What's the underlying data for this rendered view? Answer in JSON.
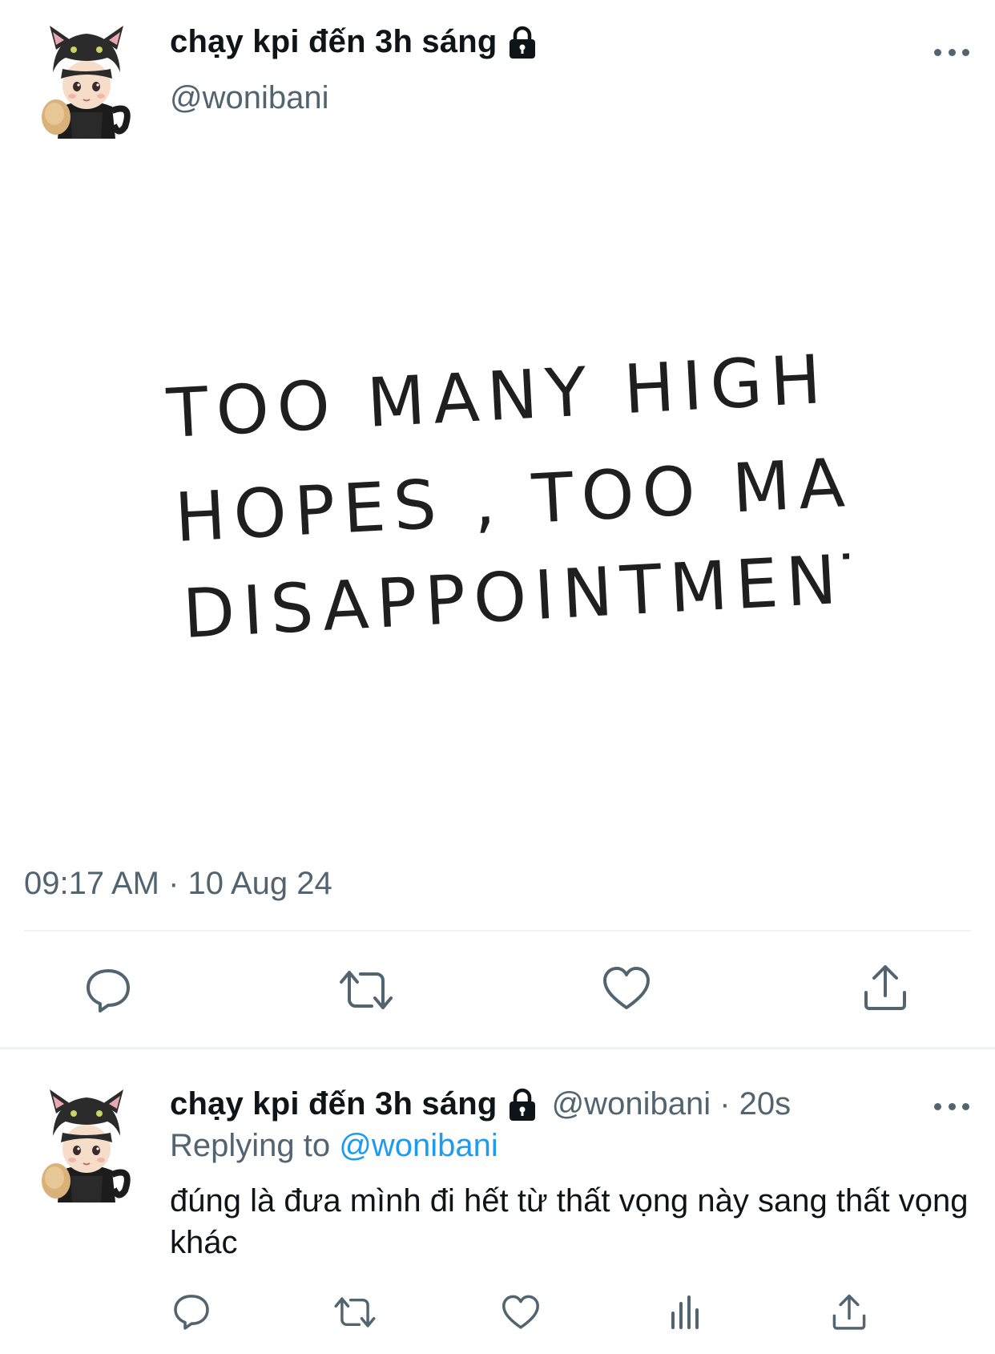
{
  "main_tweet": {
    "display_name": "chạy kpi đến 3h sáng",
    "handle": "@wonibani",
    "image_text": [
      "TOO MANY HIGH",
      "HOPES , TOO MANY",
      "DISAPPOINTMENTS."
    ],
    "timestamp": "09:17 AM · 10 Aug 24"
  },
  "reply_tweet": {
    "display_name": "chạy kpi đến 3h sáng",
    "handle_time": "@wonibani · 20s",
    "replying_prefix": "Replying to",
    "replying_mention": "@wonibani",
    "text": "đúng là đưa mình đi hết từ thất vọng này sang thất vọng khác"
  },
  "icons": {
    "reply": "speech-bubble-icon",
    "retweet": "retweet-icon",
    "like": "heart-icon",
    "views": "bar-chart-icon",
    "share": "share-upload-icon",
    "more": "more-dots-icon",
    "lock": "lock-icon"
  },
  "colors": {
    "text_primary": "#0f1419",
    "text_secondary": "#536471",
    "link": "#1d9bf0",
    "divider": "#eff3f4"
  }
}
